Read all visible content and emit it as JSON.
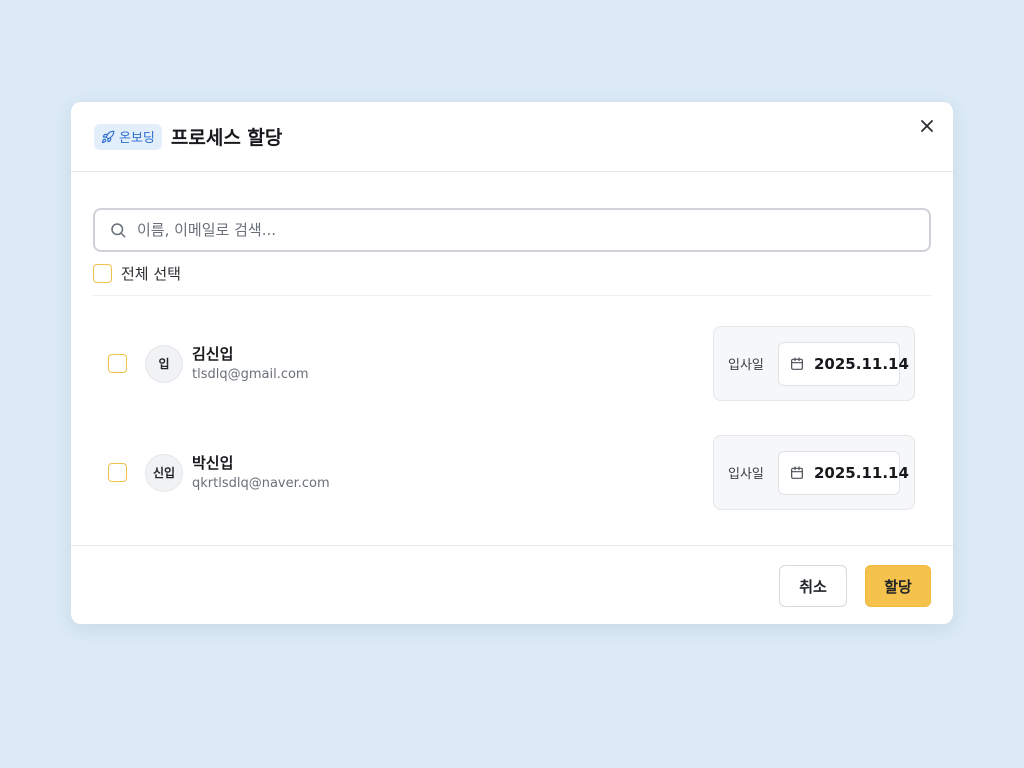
{
  "header": {
    "badge_label": "온보딩",
    "title": "프로세스 할당"
  },
  "search": {
    "placeholder": "이름, 이메일로 검색...",
    "value": ""
  },
  "select_all": {
    "label": "전체 선택",
    "checked": false
  },
  "employees": [
    {
      "avatar_text": "입",
      "name": "김신입",
      "email": "tlsdlq@gmail.com",
      "date_label": "입사일",
      "date_value": "2025.11.14",
      "checked": false
    },
    {
      "avatar_text": "신입",
      "name": "박신입",
      "email": "qkrtlsdlq@naver.com",
      "date_label": "입사일",
      "date_value": "2025.11.14",
      "checked": false
    }
  ],
  "footer": {
    "cancel_label": "취소",
    "assign_label": "할당"
  },
  "colors": {
    "background": "#dbeaf6",
    "accent": "#f4c24d",
    "badge_bg": "#e3eefb",
    "badge_text": "#2f6fd0",
    "checkbox_border": "#f0c14a"
  },
  "icons": {
    "badge": "rocket-icon",
    "close": "close-icon",
    "search": "search-icon",
    "date": "calendar-icon"
  }
}
